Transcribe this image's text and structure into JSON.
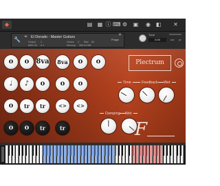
{
  "toolbar": {
    "logo_icon": "ni-logo-icon",
    "buttons": [
      "browser-icon",
      "rack-icon",
      "info-icon",
      "keyboard-icon",
      "settings-icon",
      "snapshot-icon",
      "solo-icon",
      "mute-icon",
      "close-icon"
    ]
  },
  "header": {
    "instrument_name": "El Dorado - Master Guitars",
    "output_label": "Output",
    "output_value": "1",
    "midi_label": "MIDI Ch",
    "midi_value": "A 1",
    "voices_label": "Voices",
    "voices_value": "0",
    "max_label": "Max",
    "max_value": "64",
    "memory_label": "Memory",
    "memory_value": "266.04 MB",
    "purge_label": "Purge",
    "tune_label": "Tune",
    "tune_value": "0.00",
    "aux_label": "aux",
    "pv_label": "pv"
  },
  "articulations": {
    "row1": [
      "o",
      "o",
      "8va",
      "o",
      "o",
      "o"
    ],
    "row2": [
      "♩",
      "♪",
      "o",
      "o",
      "o"
    ],
    "row3": [
      "o",
      "tr",
      "tr",
      "<>",
      "<>"
    ],
    "row4": [
      "o",
      "o",
      "tr",
      "tr"
    ]
  },
  "preset": {
    "name": "Plectrum"
  },
  "knobs": {
    "time": "Time",
    "feedback": "Feedback",
    "wet1": "Wet",
    "damping": "Damping",
    "wet2": "Wet"
  },
  "brand": {
    "mark": "F"
  },
  "colors": {
    "panel": "#a0391a",
    "keyboard_blue": "#8fb3ec",
    "keyboard_red": "#e89a98"
  }
}
